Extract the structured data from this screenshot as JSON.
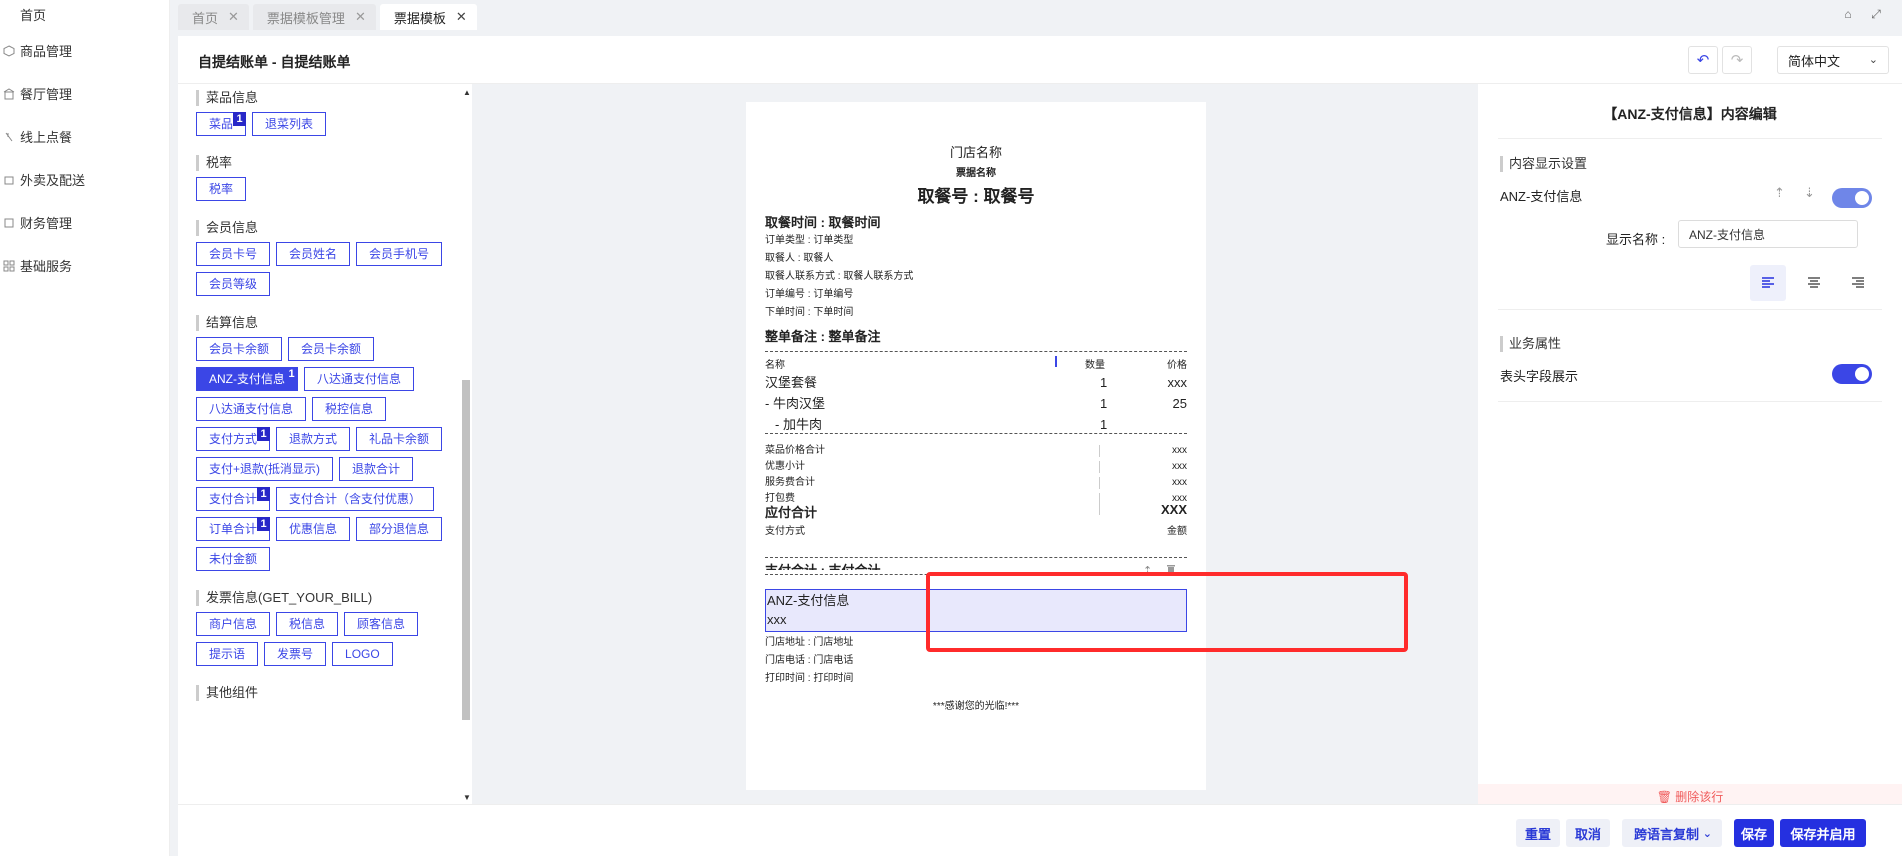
{
  "nav": {
    "items": [
      {
        "label": "首页",
        "icon": "home-icon"
      },
      {
        "label": "商品管理",
        "icon": "box-icon"
      },
      {
        "label": "餐厅管理",
        "icon": "store-icon"
      },
      {
        "label": "线上点餐",
        "icon": "order-icon"
      },
      {
        "label": "外卖及配送",
        "icon": "delivery-icon"
      },
      {
        "label": "财务管理",
        "icon": "finance-icon"
      },
      {
        "label": "基础服务",
        "icon": "grid-icon"
      }
    ]
  },
  "tabs": [
    {
      "label": "首页",
      "active": false
    },
    {
      "label": "票据模板管理",
      "active": false
    },
    {
      "label": "票据模板",
      "active": true
    }
  ],
  "header": {
    "title": "自提结账单 - 自提结账单",
    "language": "简体中文"
  },
  "components": {
    "sections": [
      {
        "title": "菜品信息",
        "chips": [
          {
            "label": "菜品",
            "badge": "1"
          },
          {
            "label": "退菜列表"
          }
        ]
      },
      {
        "title": "税率",
        "chips": [
          {
            "label": "税率"
          }
        ]
      },
      {
        "title": "会员信息",
        "chips": [
          {
            "label": "会员卡号"
          },
          {
            "label": "会员姓名"
          },
          {
            "label": "会员手机号"
          },
          {
            "label": "会员等级"
          }
        ]
      },
      {
        "title": "结算信息",
        "chips": [
          {
            "label": "会员卡余额"
          },
          {
            "label": "会员卡余额"
          },
          {
            "label": "ANZ-支付信息",
            "badge": "1",
            "selected": true
          },
          {
            "label": "八达通支付信息"
          },
          {
            "label": "八达通支付信息"
          },
          {
            "label": "税控信息"
          },
          {
            "label": "支付方式",
            "badge": "1"
          },
          {
            "label": "退款方式"
          },
          {
            "label": "礼品卡余额"
          },
          {
            "label": "支付+退款(抵消显示)"
          },
          {
            "label": "退款合计"
          },
          {
            "label": "支付合计",
            "badge": "1"
          },
          {
            "label": "支付合计（含支付优惠）"
          },
          {
            "label": "订单合计",
            "badge": "1"
          },
          {
            "label": "优惠信息"
          },
          {
            "label": "部分退信息"
          },
          {
            "label": "未付金额"
          }
        ]
      },
      {
        "title": "发票信息(GET_YOUR_BILL)",
        "chips": [
          {
            "label": "商户信息"
          },
          {
            "label": "税信息"
          },
          {
            "label": "顾客信息"
          },
          {
            "label": "提示语"
          },
          {
            "label": "发票号"
          },
          {
            "label": "LOGO"
          }
        ]
      },
      {
        "title": "其他组件",
        "chips": []
      }
    ]
  },
  "receipt": {
    "store_name": "门店名称",
    "receipt_name": "票据名称",
    "pickup_no": "取餐号 : 取餐号",
    "pickup_time": "取餐时间 : 取餐时间",
    "info_lines": [
      "订单类型 : 订单类型",
      "取餐人 : 取餐人",
      "取餐人联系方式 : 取餐人联系方式",
      "订单编号 : 订单编号",
      "下单时间 : 下单时间"
    ],
    "remark": "整单备注 : 整单备注",
    "table_headers": {
      "name": "名称",
      "qty": "数量",
      "price": "价格"
    },
    "items": [
      {
        "name": "汉堡套餐",
        "qty": "1",
        "price": "xxx"
      },
      {
        "name": "- 牛肉汉堡",
        "qty": "1",
        "price": "25"
      },
      {
        "name": "- 加牛肉",
        "qty": "1",
        "price": ""
      }
    ],
    "totals": [
      {
        "label": "菜品价格合计",
        "value": "xxx"
      },
      {
        "label": "优惠小计",
        "value": "xxx"
      },
      {
        "label": "服务费合计",
        "value": "xxx"
      },
      {
        "label": "打包费",
        "value": "xxx"
      }
    ],
    "payable_label": "应付合计",
    "payable_value": "XXX",
    "pay_method_label": "支付方式",
    "pay_method_value": "金额",
    "pay_total": "支付合计 : 支付合计",
    "anz_title": "ANZ-支付信息",
    "anz_value": "xxx",
    "footer_lines": [
      "门店地址 : 门店地址",
      "门店电话 : 门店电话",
      "打印时间 : 打印时间"
    ],
    "thanks": "***感谢您的光临!***"
  },
  "editor": {
    "title": "【ANZ-支付信息】内容编辑",
    "display_section": "内容显示设置",
    "field_name": "ANZ-支付信息",
    "display_name_label": "显示名称 :",
    "display_name_value": "ANZ-支付信息",
    "business_section": "业务属性",
    "header_field_label": "表头字段展示",
    "delete_row": "删除该行"
  },
  "footer": {
    "reset": "重置",
    "cancel": "取消",
    "cross_copy": "跨语言复制",
    "save": "保存",
    "save_enable": "保存并启用"
  },
  "colors": {
    "accent": "#3b46e6",
    "highlight": "#ff2b2b",
    "danger": "#f05b5b"
  }
}
